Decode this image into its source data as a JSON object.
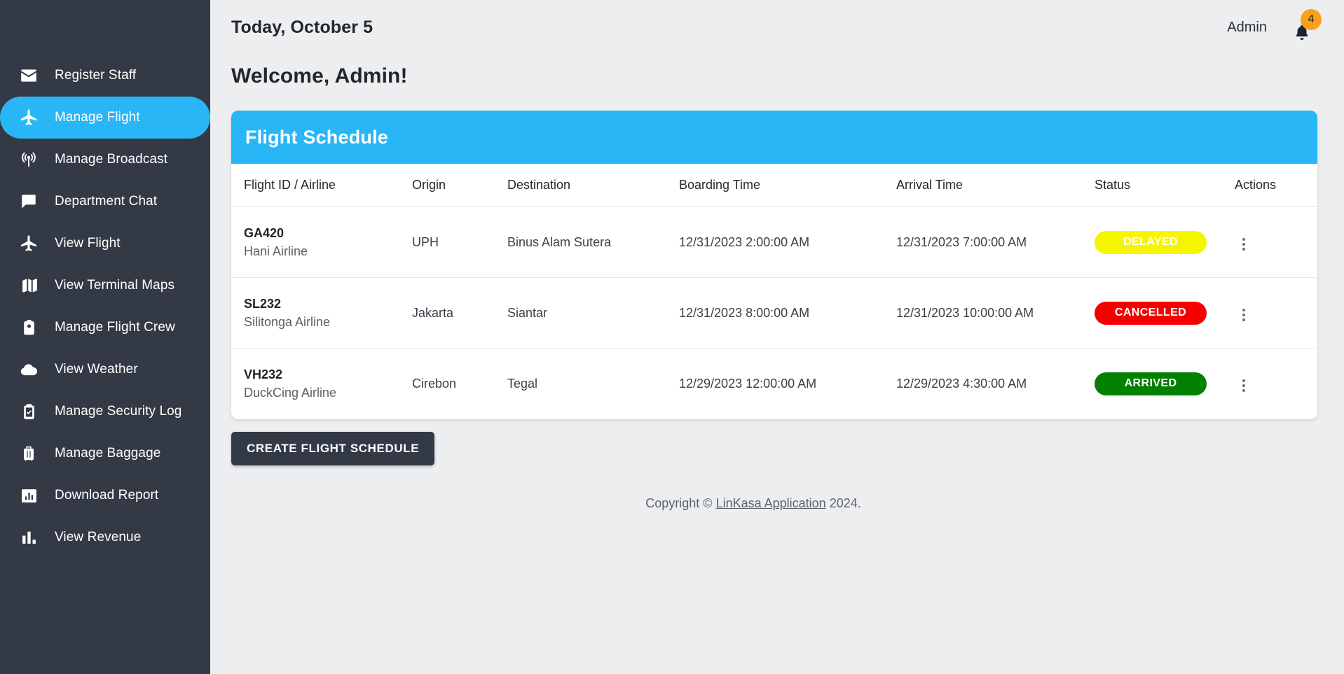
{
  "sidebar": {
    "items": [
      {
        "label": "Register Staff",
        "icon": "envelope-icon",
        "active": false
      },
      {
        "label": "Manage Flight",
        "icon": "airplane-icon",
        "active": true
      },
      {
        "label": "Manage Broadcast",
        "icon": "broadcast-icon",
        "active": false
      },
      {
        "label": "Department Chat",
        "icon": "chat-icon",
        "active": false
      },
      {
        "label": "View Flight",
        "icon": "airplane-icon",
        "active": false
      },
      {
        "label": "View Terminal Maps",
        "icon": "map-icon",
        "active": false
      },
      {
        "label": "Manage Flight Crew",
        "icon": "id-badge-icon",
        "active": false
      },
      {
        "label": "View Weather",
        "icon": "cloud-icon",
        "active": false
      },
      {
        "label": "Manage Security Log",
        "icon": "clipboard-check-icon",
        "active": false
      },
      {
        "label": "Manage Baggage",
        "icon": "suitcase-icon",
        "active": false
      },
      {
        "label": "Download Report",
        "icon": "chart-box-icon",
        "active": false
      },
      {
        "label": "View Revenue",
        "icon": "bar-chart-icon",
        "active": false
      }
    ]
  },
  "topbar": {
    "today": "Today, October 5",
    "admin_label": "Admin",
    "bell_icon": "bell-icon",
    "notification_count": "4"
  },
  "page": {
    "welcome": "Welcome, Admin!"
  },
  "flight_schedule": {
    "title": "Flight Schedule",
    "columns": [
      "Flight ID / Airline",
      "Origin",
      "Destination",
      "Boarding Time",
      "Arrival Time",
      "Status",
      "Actions"
    ],
    "rows": [
      {
        "flight_id": "GA420",
        "airline": "Hani Airline",
        "origin": "UPH",
        "destination": "Binus Alam Sutera",
        "boarding_time": "12/31/2023 2:00:00 AM",
        "arrival_time": "12/31/2023 7:00:00 AM",
        "status": "DELAYED",
        "status_bg": "#f5f500",
        "status_fg": "#ffffff",
        "actions_icon": "kebab-menu-icon"
      },
      {
        "flight_id": "SL232",
        "airline": "Silitonga Airline",
        "origin": "Jakarta",
        "destination": "Siantar",
        "boarding_time": "12/31/2023 8:00:00 AM",
        "arrival_time": "12/31/2023 10:00:00 AM",
        "status": "CANCELLED",
        "status_bg": "#f50000",
        "status_fg": "#ffffff",
        "actions_icon": "kebab-menu-icon"
      },
      {
        "flight_id": "VH232",
        "airline": "DuckCing Airline",
        "origin": "Cirebon",
        "destination": "Tegal",
        "boarding_time": "12/29/2023 12:00:00 AM",
        "arrival_time": "12/29/2023 4:30:00 AM",
        "status": "ARRIVED",
        "status_bg": "#028000",
        "status_fg": "#ffffff",
        "actions_icon": "kebab-menu-icon"
      }
    ]
  },
  "create_button": {
    "label": "CREATE FLIGHT SCHEDULE"
  },
  "footer": {
    "prefix": "Copyright © ",
    "link": "LinKasa Application",
    "suffix": " 2024."
  },
  "colors": {
    "accent": "#29b6f6",
    "sidebar_bg": "#333a45",
    "page_bg": "#eceef0",
    "badge_orange": "#f9a11b"
  }
}
